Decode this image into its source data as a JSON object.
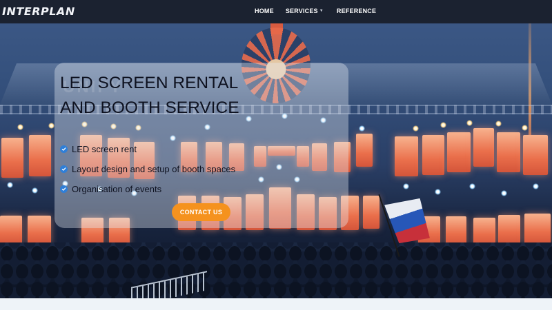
{
  "brand": {
    "logo_text": "INTERPLAN"
  },
  "nav": {
    "home": "HOME",
    "services": "SERVICES",
    "reference": "REFERENCE"
  },
  "hero": {
    "title_line1": "LED SCREEN RENTAL",
    "title_line2": "AND BOOTH SERVICE",
    "watermark": "UNIFY",
    "features": [
      {
        "text": "LED screen rent",
        "icon": "check-circle-icon"
      },
      {
        "text": "Layout design and setup of booth spaces",
        "icon": "check-circle-icon"
      },
      {
        "text": "Organisation of events",
        "icon": "check-circle-icon"
      }
    ],
    "cta_label": "CONTACT US"
  },
  "colors": {
    "navbar": "#1b2230",
    "accent": "#f5921e",
    "check": "#2f7fd8",
    "text": "#0e1220"
  },
  "icons": {
    "services_dropdown": "chevron-down-icon"
  }
}
